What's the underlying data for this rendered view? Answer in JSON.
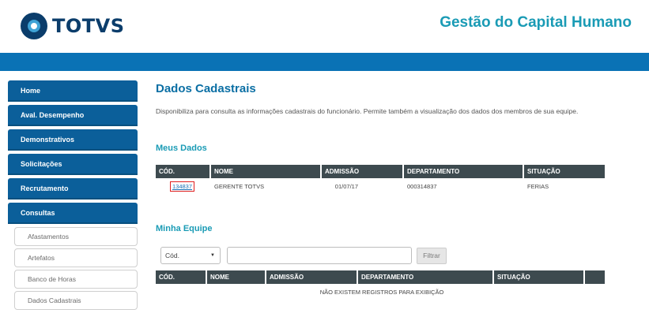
{
  "header": {
    "logo_text": "TOTVS",
    "app_title": "Gestão do Capital Humano"
  },
  "sidebar": {
    "items": [
      {
        "label": "Home"
      },
      {
        "label": "Aval. Desempenho"
      },
      {
        "label": "Demonstrativos"
      },
      {
        "label": "Solicitações"
      },
      {
        "label": "Recrutamento"
      },
      {
        "label": "Consultas"
      }
    ],
    "sub_items": [
      {
        "label": "Afastamentos"
      },
      {
        "label": "Artefatos"
      },
      {
        "label": "Banco de Horas"
      },
      {
        "label": "Dados Cadastrais"
      }
    ]
  },
  "main": {
    "title": "Dados Cadastrais",
    "description": "Disponibiliza para consulta as informações cadastrais do funcionário. Permite também a visualização dos dados dos membros de sua equipe.",
    "meus_dados": {
      "title": "Meus Dados",
      "columns": [
        "CÓD.",
        "NOME",
        "ADMISSÃO",
        "DEPARTAMENTO",
        "SITUAÇÃO"
      ],
      "row": {
        "cod": "134837",
        "nome": "GERENTE TOTVS",
        "admissao": "01/07/17",
        "departamento": "000314837",
        "situacao": "FERIAS"
      }
    },
    "minha_equipe": {
      "title": "Minha Equipe",
      "filter_select": "Cód.",
      "filter_input_value": "",
      "filter_button": "Filtrar",
      "columns": [
        "CÓD.",
        "NOME",
        "ADMISSÃO",
        "DEPARTAMENTO",
        "SITUAÇÃO"
      ],
      "empty_message": "NÃO EXISTEM REGISTROS PARA EXIBIÇÃO"
    }
  },
  "colors": {
    "brand_navy": "#0b3d6b",
    "brand_teal": "#1a9bb5",
    "top_bar": "#0a72b5",
    "nav_button": "#0b5f9a",
    "table_header": "#3d4a4f",
    "highlight_border": "#e02020"
  }
}
